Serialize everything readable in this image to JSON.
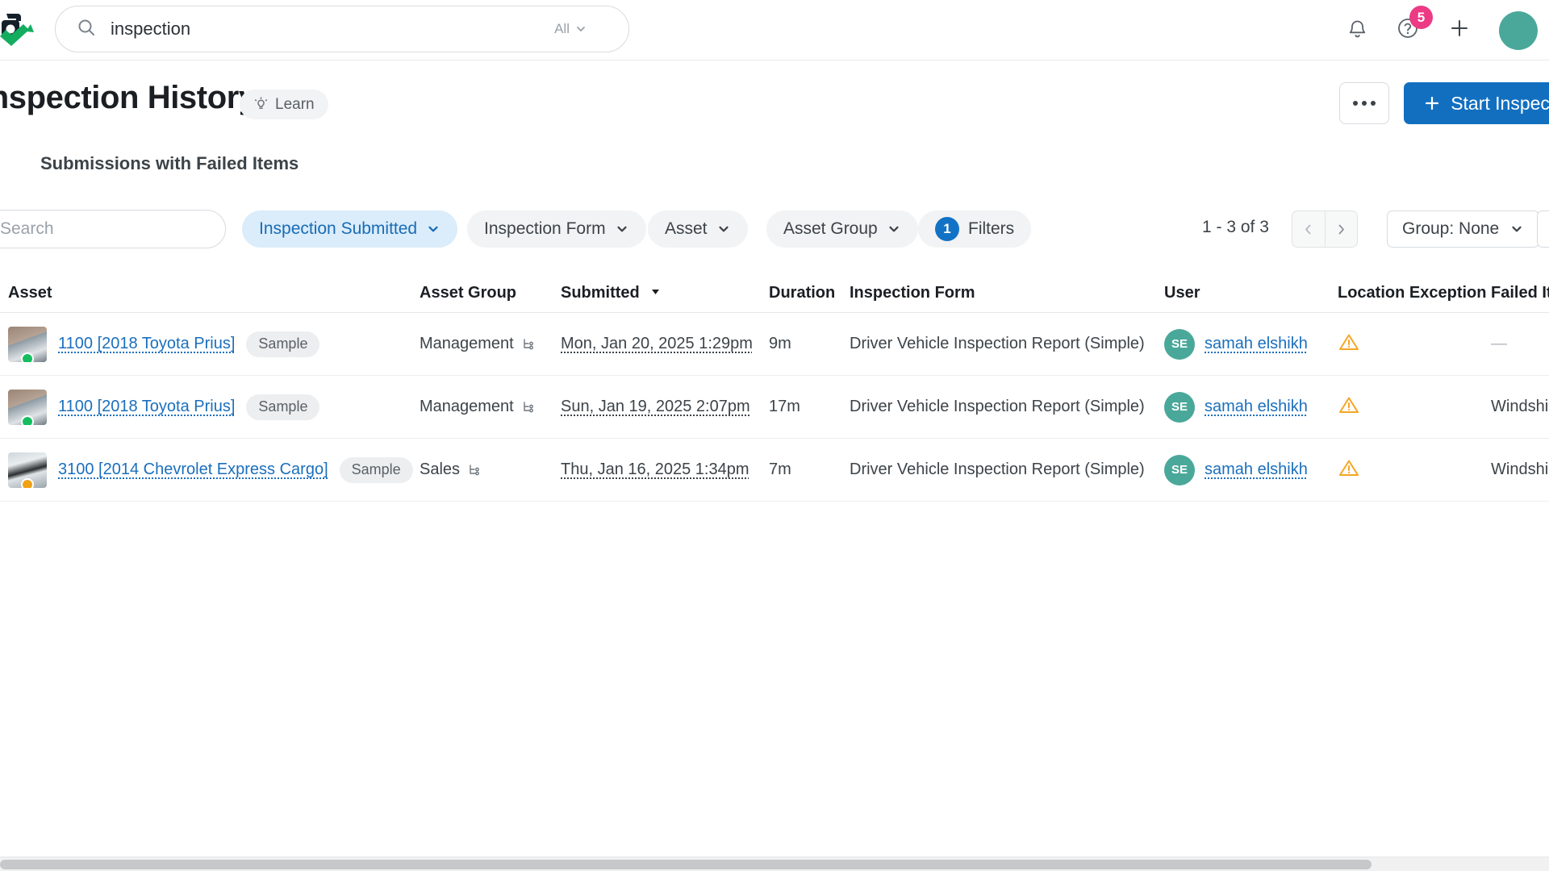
{
  "nav": {
    "logo_name": "fleetio-logo",
    "search_value": "inspection",
    "search_placeholder": "Search",
    "scope_label": "All",
    "notifications_icon": "bell-icon",
    "help_icon": "question-circle-icon",
    "help_badge": "5",
    "add_icon": "plus-icon",
    "avatar_label": ""
  },
  "header": {
    "title": "Inspection History",
    "learn_label": "Learn",
    "more_label": "",
    "start_inspection_label": "Start Inspection",
    "subtitle": "Submissions with Failed Items"
  },
  "filters": {
    "search_placeholder": "Search",
    "search_value": "",
    "pills": [
      {
        "label": "Inspection Submitted",
        "active": true
      },
      {
        "label": "Inspection Form",
        "active": false
      },
      {
        "label": "Asset",
        "active": false
      },
      {
        "label": "Asset Group",
        "active": false
      }
    ],
    "filters_count": "1",
    "filters_label": "Filters",
    "page_count": "1 - 3 of 3",
    "prev_label": "‹",
    "next_label": "›",
    "group_label": "Group: None"
  },
  "table": {
    "columns": [
      "Asset",
      "Asset Group",
      "Submitted",
      "Duration",
      "Inspection Form",
      "User",
      "Location Exception",
      "Failed Items"
    ],
    "sorted_column": "Submitted",
    "sort_direction": "desc",
    "rows": [
      {
        "asset": "1100 [2018 Toyota Prius]",
        "asset_tag": "Sample",
        "asset_status": "green",
        "asset_thumb": "car",
        "asset_group": "Management",
        "submitted": "Mon, Jan 20, 2025 1:29pm",
        "duration": "9m",
        "inspection_form": "Driver Vehicle Inspection Report (Simple)",
        "user_initials": "SE",
        "user": "samah elshikh",
        "location_exception": "warning-triangle-icon",
        "failed_items": "—"
      },
      {
        "asset": "1100 [2018 Toyota Prius]",
        "asset_tag": "Sample",
        "asset_status": "green",
        "asset_thumb": "car",
        "asset_group": "Management",
        "submitted": "Sun, Jan 19, 2025 2:07pm",
        "duration": "17m",
        "inspection_form": "Driver Vehicle Inspection Report (Simple)",
        "user_initials": "SE",
        "user": "samah elshikh",
        "location_exception": "warning-triangle-icon",
        "failed_items": "Windshield"
      },
      {
        "asset": "3100 [2014 Chevrolet Express Cargo]",
        "asset_tag": "Sample",
        "asset_status": "orange",
        "asset_thumb": "van",
        "asset_group": "Sales",
        "submitted": "Thu, Jan 16, 2025 1:34pm",
        "duration": "7m",
        "inspection_form": "Driver Vehicle Inspection Report (Simple)",
        "user_initials": "SE",
        "user": "samah elshikh",
        "location_exception": "warning-triangle-icon",
        "failed_items": "Windshield"
      }
    ]
  },
  "colors": {
    "primary": "#126fc0",
    "link": "#1a6fbd",
    "badge_pink": "#ec3a84",
    "warning": "#f5a623",
    "status_green": "#16bd5e",
    "status_orange": "#f0a117",
    "avatar_teal": "#4aa89a"
  }
}
